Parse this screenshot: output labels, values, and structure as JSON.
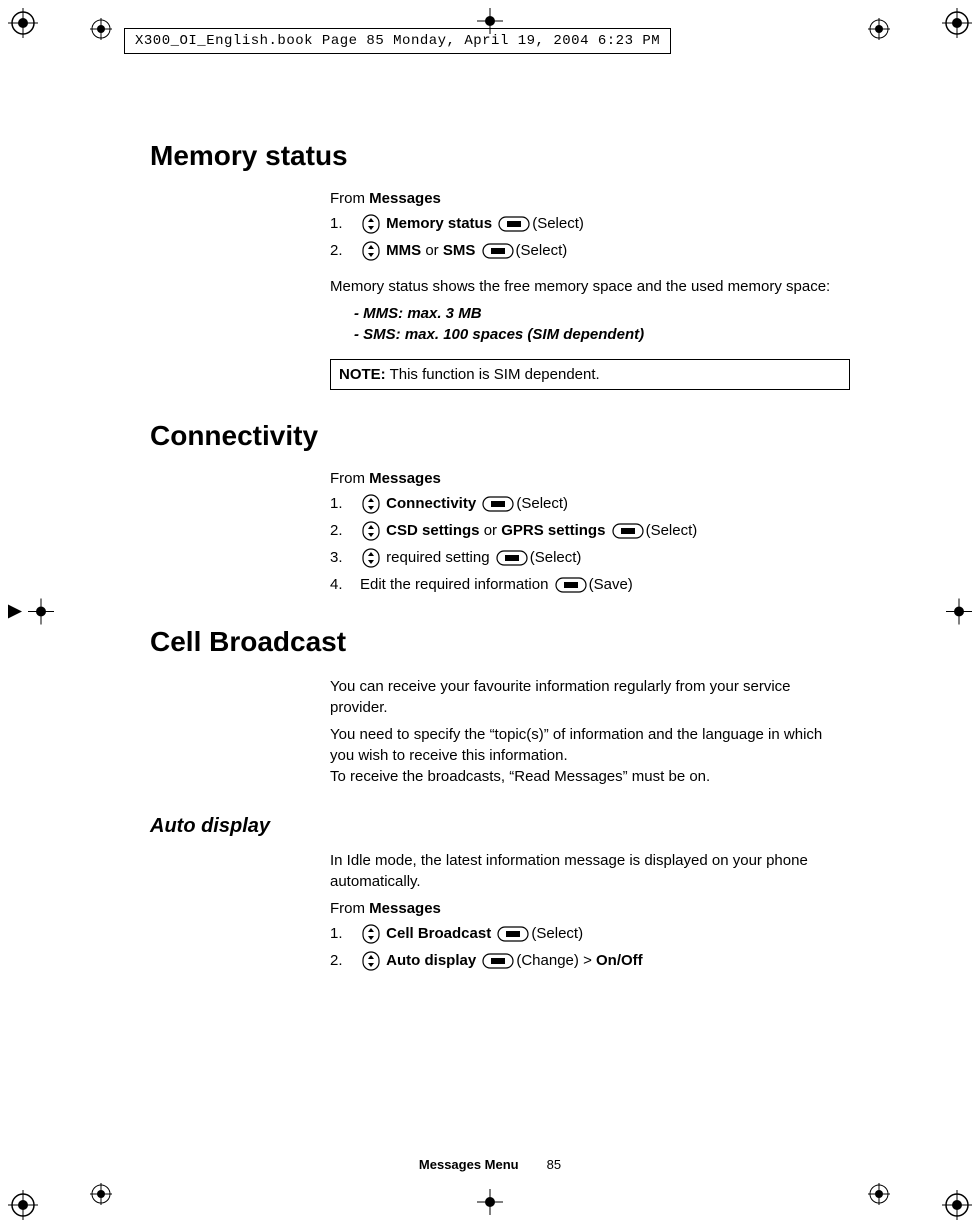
{
  "header": "X300_OI_English.book  Page 85  Monday, April 19, 2004  6:23 PM",
  "sections": {
    "memory": {
      "title": "Memory status",
      "from": "Messages",
      "steps": {
        "s1_bold": "Memory status",
        "s1_action": "(Select)",
        "s2_a": "MMS",
        "s2_or": " or ",
        "s2_b": "SMS",
        "s2_action": "(Select)"
      },
      "desc": "Memory status shows the free memory space and the used memory space:",
      "bullets": {
        "b1": "MMS: max. 3 MB",
        "b2": "SMS: max. 100 spaces (SIM dependent)"
      },
      "note_label": "NOTE:",
      "note_text": " This function is SIM dependent."
    },
    "connectivity": {
      "title": "Connectivity",
      "from": "Messages",
      "steps": {
        "s1_bold": "Connectivity",
        "s1_action": "(Select)",
        "s2_a": "CSD settings",
        "s2_or": " or ",
        "s2_b": "GPRS settings",
        "s2_action": "(Select)",
        "s3_text": " required setting ",
        "s3_action": "(Select)",
        "s4_text": "Edit the required information ",
        "s4_action": "(Save)"
      }
    },
    "cell": {
      "title": "Cell Broadcast",
      "p1": "You can receive your favourite information regularly from your service provider.",
      "p2": "You need to specify the “topic(s)” of information and the language in which you wish to receive this information.",
      "p3": "To receive the broadcasts, “Read Messages” must be on.",
      "auto": {
        "title": "Auto display",
        "desc": "In Idle mode, the latest information message is displayed on your phone automatically.",
        "from": "Messages",
        "steps": {
          "s1_bold": "Cell Broadcast",
          "s1_action": "(Select)",
          "s2_bold": "Auto display",
          "s2_action": "(Change)",
          "s2_gt": " > ",
          "s2_onoff": "On/Off"
        }
      }
    }
  },
  "footer": {
    "section": "Messages Menu",
    "page": "85"
  }
}
